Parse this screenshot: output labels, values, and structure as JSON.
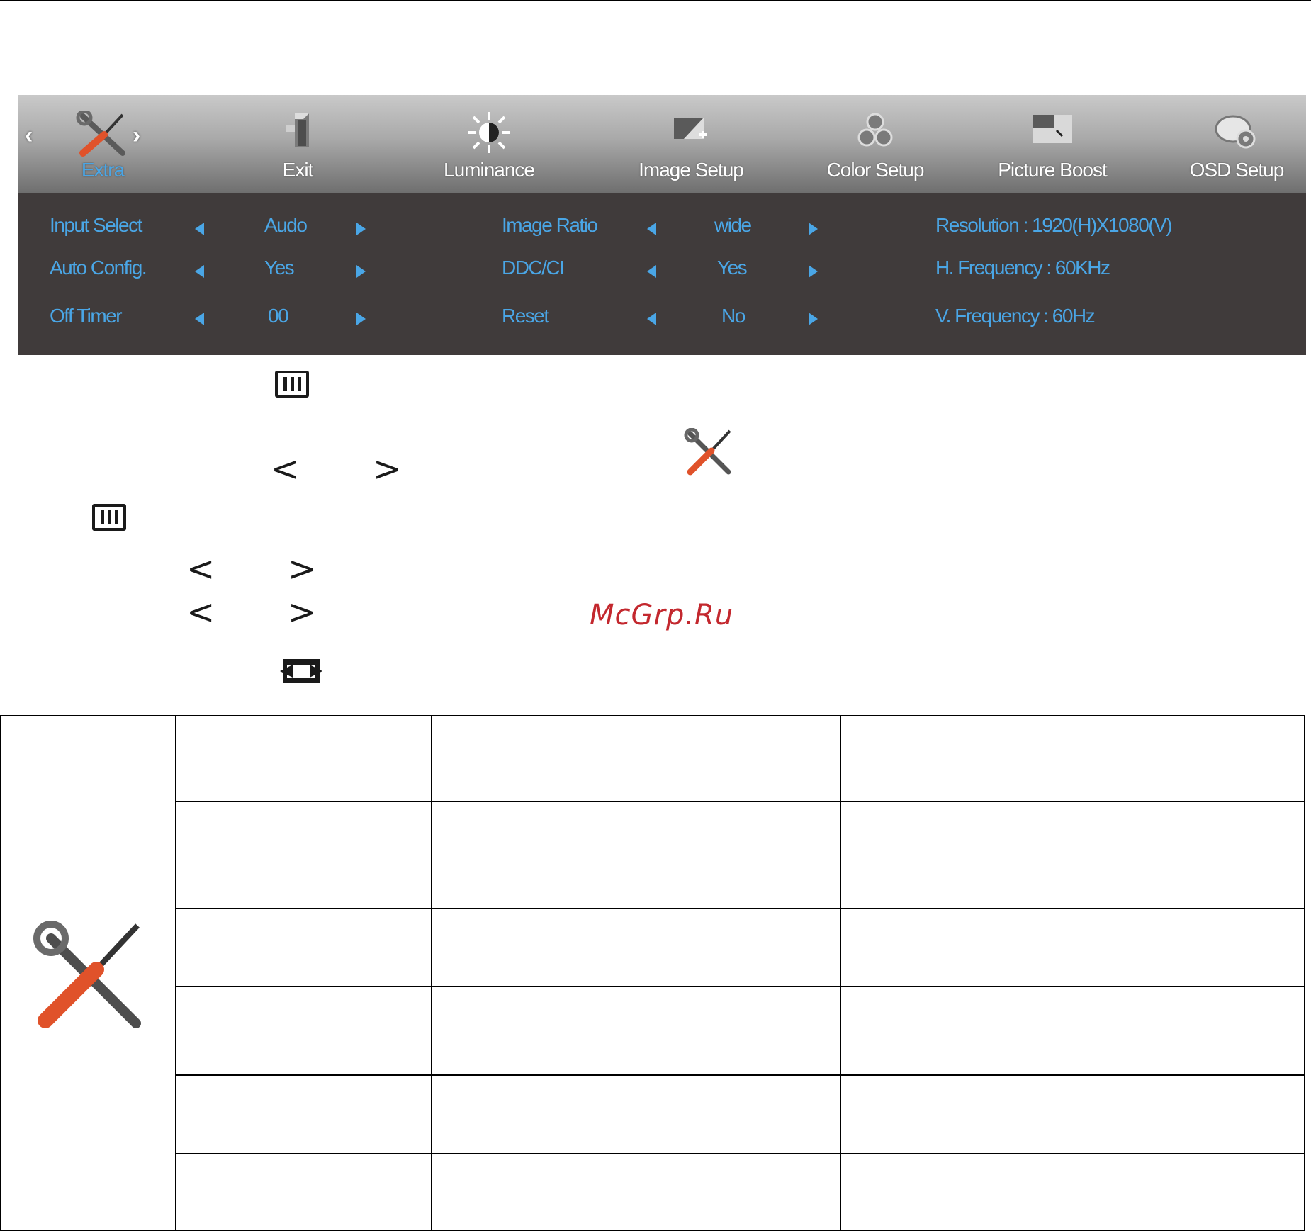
{
  "osd": {
    "tabs": [
      {
        "label": "Extra",
        "icon": "tools-icon",
        "active": true
      },
      {
        "label": "Exit",
        "icon": "exit-icon"
      },
      {
        "label": "Luminance",
        "icon": "brightness-icon"
      },
      {
        "label": "Image Setup",
        "icon": "image-setup-icon"
      },
      {
        "label": "Color Setup",
        "icon": "color-setup-icon"
      },
      {
        "label": "Picture Boost",
        "icon": "picture-boost-icon"
      },
      {
        "label": "OSD Setup",
        "icon": "osd-setup-icon"
      }
    ],
    "left_column": [
      {
        "label": "Input Select",
        "value": "Audo"
      },
      {
        "label": "Auto Config.",
        "value": "Yes"
      },
      {
        "label": "Off Timer",
        "value": "00"
      }
    ],
    "middle_column": [
      {
        "label": "Image Ratio",
        "value": "wide"
      },
      {
        "label": "DDC/CI",
        "value": "Yes"
      },
      {
        "label": "Reset",
        "value": "No"
      }
    ],
    "info": {
      "resolution": "Resolution : 1920(H)X1080(V)",
      "h_frequency": "H. Frequency : 60KHz",
      "v_frequency": "V. Frequency : 60Hz"
    },
    "colors": {
      "accent": "#4aa6e6",
      "body_bg": "#403b3b"
    }
  },
  "instructions": {
    "chevron_left": "<",
    "chevron_right": ">"
  },
  "watermark": "McGrp.Ru",
  "table": {
    "icon": "tools-icon"
  }
}
